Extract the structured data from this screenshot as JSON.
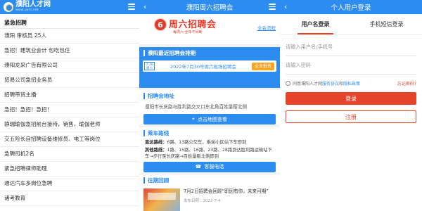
{
  "colors": {
    "primary": "#2d8cf0",
    "accent_red": "#e6442a",
    "tag_orange": "#f5a623"
  },
  "panel1": {
    "logo": {
      "text": "濮阳人才网",
      "url": "www.pyrc.net"
    },
    "menu_icon": "menu-icon",
    "list_title": "紧急招聘",
    "jobs": [
      "濮阳 审核员 25人",
      "急招！建筑业会计 包吃包住",
      "濮阳龙采广告有限公司",
      "贸易公司急招业务员",
      "招聘带货主播",
      "急招！急招！急招！",
      "静瑞瑜伽急招前台接待，销售，瑜伽老师",
      "交五险长自招聘设备维修员、电工等岗位",
      "急聘司机2名",
      "紧急招聘律师助理",
      "通达汽车多岗位急聘",
      "诸考教育"
    ]
  },
  "panel2": {
    "header_title": "濮阳周六招聘会",
    "back_icon": "back-icon",
    "banner": {
      "number": "6",
      "title": "周六招聘会",
      "subtitle": "每周六·全年不间断",
      "link": "全会流程"
    },
    "recent": {
      "title": "濮阳最近招聘会排期",
      "date": "7-30 周六",
      "text": "2022年7月30号周六现场招聘会",
      "tag": "企业报名"
    },
    "address": {
      "title": "招聘会地址",
      "text": "濮阳市长庆路与胜利路交叉口东北角百姓量贩北侧",
      "button": "点击地图查看"
    },
    "route": {
      "title": "乘车路线",
      "direct_label": "直达路线：",
      "direct_text": "6路、13路公交车，乘坐小区站下车即到",
      "other_label": "其他路线：",
      "other_text": "1路、15路、16路、23路、28路到达胜利路运输站下车→步行至长庆路→百姓量贩北侧即到",
      "button": "客服电话"
    },
    "review": {
      "title": "往期回顾",
      "news_title": "7月2日招聘会回顾“职因有你，未来可期”",
      "news_date": "发布日期：2022-7-4"
    }
  },
  "panel3": {
    "header_title": "个人用户登录",
    "tabs": [
      "用户名登录",
      "手机短信登录"
    ],
    "username_placeholder": "请输入用户名/手机号",
    "password_placeholder": "请输入密码",
    "agree_text": "同意濮阳人才网",
    "service_link": "服务协议",
    "and_text": "和",
    "privacy_link": "隐私政策",
    "forgot": "忘记密码?",
    "login_button": "登录",
    "register_button": "注册"
  }
}
